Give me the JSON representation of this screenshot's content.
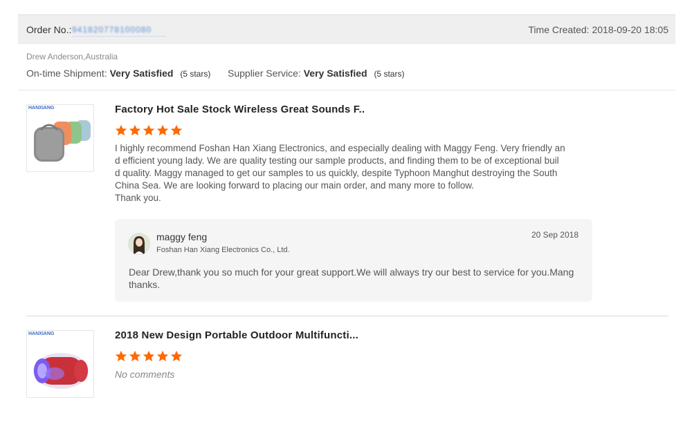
{
  "order": {
    "order_no_label": "Order No.:",
    "order_no_value": "941820778100080",
    "time_created": "Time Created: 2018-09-20 18:05"
  },
  "buyer": {
    "name_country": "Drew Anderson,Australia"
  },
  "ratings": {
    "shipment_label": "On-time Shipment:",
    "shipment_value": "Very Satisfied",
    "shipment_stars": "(5 stars)",
    "supplier_label": "Supplier Service:",
    "supplier_value": "Very Satisfied",
    "supplier_stars": "(5 stars)"
  },
  "products": [
    {
      "brand": "HANXIANG",
      "title": "Factory Hot Sale Stock Wireless Great Sounds F..",
      "rating": 5,
      "review_lines": [
        "I highly recommend Foshan Han Xiang Electronics, and especially dealing with Maggy Feng. Very friendly an",
        "d efficient young lady. We are quality testing our sample products, and finding them to be of exceptional buil",
        "d quality. Maggy managed to get our samples to us quickly, despite Typhoon Manghut destroying the South",
        "China Sea. We are looking forward to placing our main order, and many more to follow.",
        "Thank you."
      ]
    },
    {
      "brand": "HANXIANG",
      "title": "2018 New Design Portable Outdoor Multifuncti...",
      "rating": 5,
      "no_comments": "No comments"
    }
  ],
  "reply": {
    "name": "maggy feng",
    "company": "Foshan Han Xiang Electronics Co., Ltd.",
    "date": "20 Sep 2018",
    "text_lines": [
      "Dear Drew,thank you so much for your great support.We will always try our best to service for you.Mang",
      "thanks."
    ]
  },
  "colors": {
    "star": "#ff6a00",
    "header_bg": "#efefef",
    "reply_bg": "#f5f5f5"
  },
  "icons": {
    "star": "star-icon",
    "avatar": "avatar"
  }
}
